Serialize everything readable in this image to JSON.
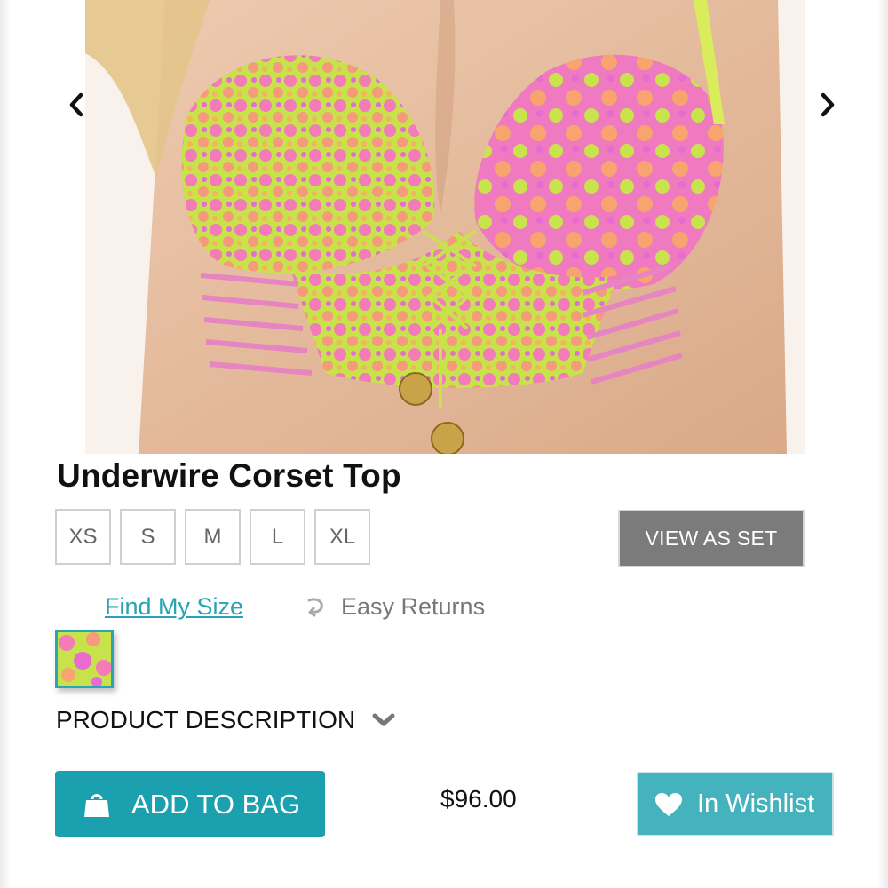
{
  "product": {
    "title": "Underwire Corset Top",
    "price": "$96.00"
  },
  "sizes": [
    "XS",
    "S",
    "M",
    "L",
    "XL"
  ],
  "buttons": {
    "view_as_set": "VIEW AS SET",
    "add_to_bag": "ADD TO BAG",
    "wishlist": "In Wishlist"
  },
  "links": {
    "find_my_size": "Find My Size",
    "easy_returns": "Easy Returns"
  },
  "sections": {
    "product_description": "PRODUCT DESCRIPTION"
  },
  "icons": {
    "prev": "chevron-left-icon",
    "next": "chevron-right-icon",
    "returns": "return-arrow-icon",
    "description_toggle": "chevron-down-icon",
    "bag": "shopping-bag-icon",
    "wishlist": "heart-icon"
  },
  "colors": {
    "accent": "#1aa0ae",
    "wishlist": "#45b3be",
    "link": "#25a4b4",
    "view_as_set": "#7b7b7b"
  }
}
